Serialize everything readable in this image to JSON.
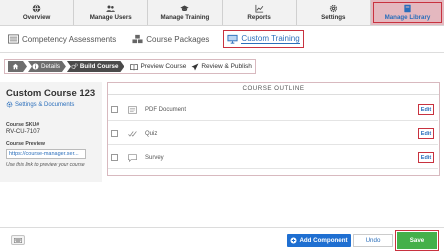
{
  "topnav": {
    "items": [
      {
        "label": "Overview",
        "icon": "globe-icon"
      },
      {
        "label": "Manage Users",
        "icon": "users-icon"
      },
      {
        "label": "Manage Training",
        "icon": "graduation-cap-icon"
      },
      {
        "label": "Reports",
        "icon": "chart-icon"
      },
      {
        "label": "Settings",
        "icon": "gear-icon"
      },
      {
        "label": "Manage Library",
        "icon": "book-icon",
        "active": true
      }
    ]
  },
  "subtabs": [
    {
      "label": "Competency Assessments",
      "icon": "list-icon"
    },
    {
      "label": "Course Packages",
      "icon": "boxes-icon"
    },
    {
      "label": "Custom Training",
      "icon": "monitor-icon",
      "active": true
    }
  ],
  "breadcrumb": {
    "home_icon": "home-icon",
    "details": "Details",
    "build": "Build Course",
    "preview": "Preview Course",
    "review": "Review & Publish"
  },
  "course": {
    "title": "Custom Course 123",
    "settings_link": "Settings & Documents",
    "sku_label": "Course SKU#",
    "sku_value": "RV-CU-7107",
    "preview_label": "Course Preview",
    "preview_url": "https://course-manager.ser...",
    "preview_help": "Use this link to preview your course"
  },
  "outline": {
    "header": "COURSE OUTLINE",
    "items": [
      {
        "label": "PDF Document",
        "icon": "document-icon",
        "edit": "Edit"
      },
      {
        "label": "Quiz",
        "icon": "checkmarks-icon",
        "edit": "Edit"
      },
      {
        "label": "Survey",
        "icon": "comment-icon",
        "edit": "Edit"
      }
    ]
  },
  "footer": {
    "keyboard_icon": "keyboard-icon",
    "add_component": "Add Component",
    "undo": "Undo",
    "save": "Save"
  },
  "colors": {
    "accent": "#2a6ebb",
    "highlight_border": "#c8323f",
    "save_green": "#44b04a",
    "add_blue": "#1f6fd1"
  }
}
